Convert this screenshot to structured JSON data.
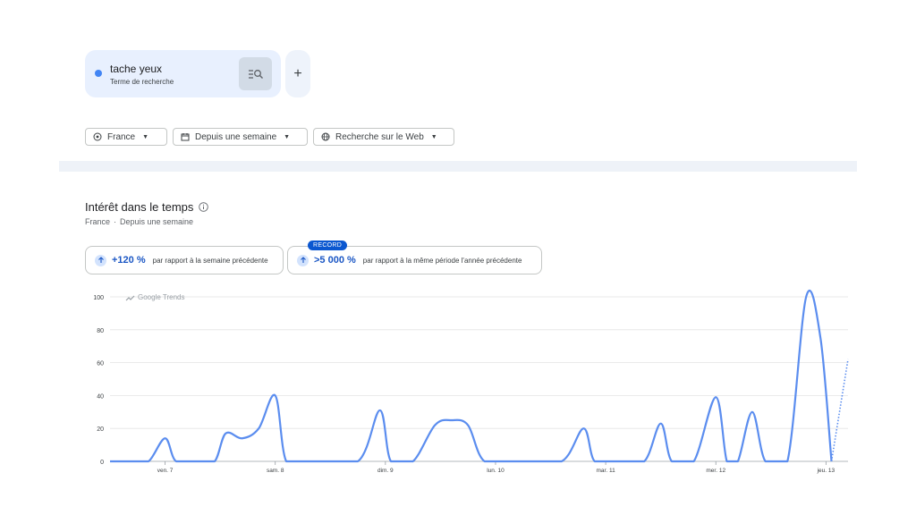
{
  "term": {
    "name": "tache yeux",
    "subtitle": "Terme de recherche"
  },
  "add_label": "+",
  "filters": {
    "geo": "France",
    "time": "Depuis une semaine",
    "property": "Recherche sur le Web"
  },
  "section": {
    "title": "Intérêt dans le temps",
    "sub_geo": "France",
    "sub_sep": "·",
    "sub_time": "Depuis une semaine"
  },
  "stats": [
    {
      "value": "+120 %",
      "text": "par rapport à la semaine précédente"
    },
    {
      "value": ">5 000 %",
      "text": "par rapport à la même période l'année précédente",
      "badge": "RECORD"
    }
  ],
  "watermark": "Google Trends",
  "colors": {
    "line": "#5b8def",
    "accent": "#0b57d0",
    "card": "#e8f0fe"
  },
  "chart_data": {
    "type": "line",
    "ylim": [
      0,
      100
    ],
    "yticks": [
      0,
      20,
      40,
      60,
      80,
      100
    ],
    "grid": true,
    "xlabels": [
      {
        "x": 1,
        "label": "ven. 7"
      },
      {
        "x": 2,
        "label": "sam. 8"
      },
      {
        "x": 3,
        "label": "dim. 9"
      },
      {
        "x": 4,
        "label": "lun. 10"
      },
      {
        "x": 5,
        "label": "mar. 11"
      },
      {
        "x": 6,
        "label": "mer. 12"
      },
      {
        "x": 7,
        "label": "jeu. 13"
      }
    ],
    "series": [
      {
        "points": [
          [
            0.5,
            0
          ],
          [
            0.7,
            0
          ],
          [
            0.85,
            0
          ],
          [
            1.0,
            14
          ],
          [
            1.1,
            0
          ],
          [
            1.3,
            0
          ],
          [
            1.45,
            0
          ],
          [
            1.55,
            17
          ],
          [
            1.7,
            14
          ],
          [
            1.85,
            20
          ],
          [
            2.0,
            40
          ],
          [
            2.1,
            0
          ],
          [
            2.3,
            0
          ],
          [
            2.75,
            0
          ],
          [
            2.95,
            31
          ],
          [
            3.05,
            0
          ],
          [
            3.25,
            0
          ],
          [
            3.45,
            22
          ],
          [
            3.6,
            25
          ],
          [
            3.75,
            22
          ],
          [
            3.9,
            0
          ],
          [
            4.2,
            0
          ],
          [
            4.6,
            0
          ],
          [
            4.8,
            20
          ],
          [
            4.9,
            0
          ],
          [
            5.1,
            0
          ],
          [
            5.35,
            0
          ],
          [
            5.5,
            23
          ],
          [
            5.6,
            0
          ],
          [
            5.8,
            0
          ],
          [
            6.0,
            39
          ],
          [
            6.1,
            0
          ],
          [
            6.2,
            0
          ],
          [
            6.33,
            30
          ],
          [
            6.45,
            0
          ],
          [
            6.65,
            0
          ],
          [
            6.82,
            100
          ],
          [
            6.95,
            75
          ],
          [
            7.05,
            0
          ]
        ],
        "projection": [
          [
            7.05,
            0
          ],
          [
            7.2,
            62
          ]
        ]
      }
    ]
  }
}
